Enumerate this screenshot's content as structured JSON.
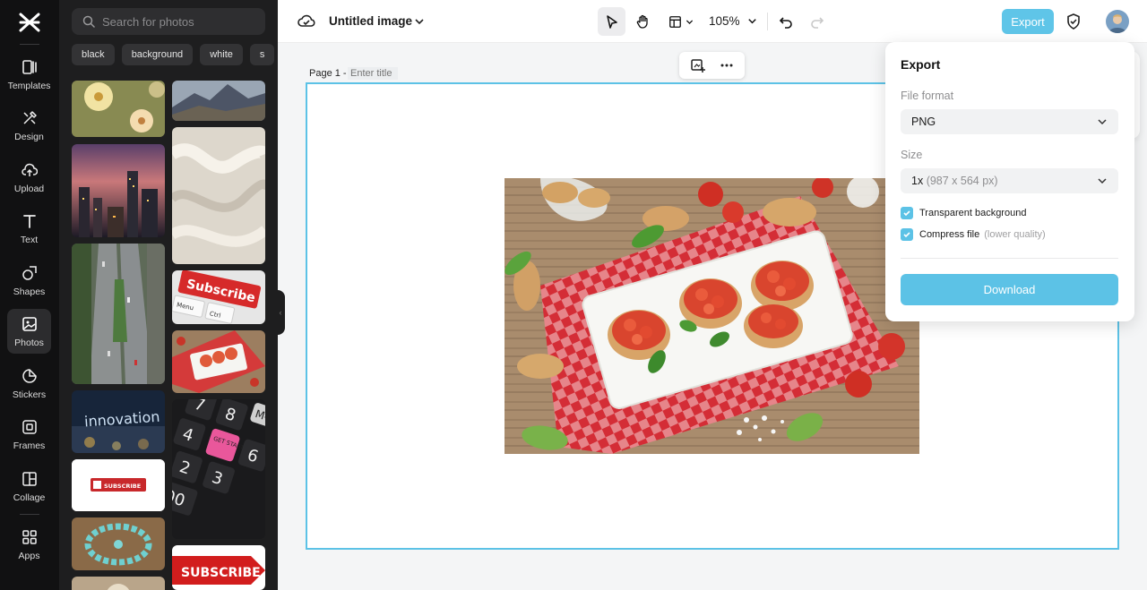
{
  "rail": {
    "items": [
      {
        "label": "Templates",
        "icon": "templates-icon"
      },
      {
        "label": "Design",
        "icon": "design-icon"
      },
      {
        "label": "Upload",
        "icon": "upload-icon"
      },
      {
        "label": "Text",
        "icon": "text-icon"
      },
      {
        "label": "Shapes",
        "icon": "shapes-icon"
      },
      {
        "label": "Photos",
        "icon": "photos-icon",
        "active": true
      },
      {
        "label": "Stickers",
        "icon": "stickers-icon"
      },
      {
        "label": "Frames",
        "icon": "frames-icon"
      },
      {
        "label": "Collage",
        "icon": "collage-icon"
      },
      {
        "label": "Apps",
        "icon": "apps-icon"
      }
    ]
  },
  "photos": {
    "search_placeholder": "Search for photos",
    "tags": [
      "black",
      "background",
      "white",
      "s"
    ],
    "thumb_texts": {
      "innovation": "innovation",
      "subscribe_key": "Subscribe",
      "menu_key": "Menu",
      "ctrl_key": "Ctrl",
      "get_started": "GET STARTED",
      "subscribe_small": "SUBSCRIBE",
      "subscribe_banner": "SUBSCRIBE"
    }
  },
  "topbar": {
    "title": "Untitled image",
    "zoom": "105%",
    "export_label": "Export"
  },
  "canvas": {
    "page_label": "Page 1 -",
    "title_placeholder": "Enter title"
  },
  "export_panel": {
    "title": "Export",
    "file_format_label": "File format",
    "file_format_value": "PNG",
    "size_label": "Size",
    "size_value": "1x",
    "size_dims": "(987 x 564 px)",
    "transparent_label": "Transparent background",
    "compress_label": "Compress file",
    "compress_note": "(lower quality)",
    "download_label": "Download"
  },
  "colors": {
    "accent": "#5cc2e6",
    "rail_bg": "#111112",
    "panel_bg": "#1e1e1f"
  }
}
